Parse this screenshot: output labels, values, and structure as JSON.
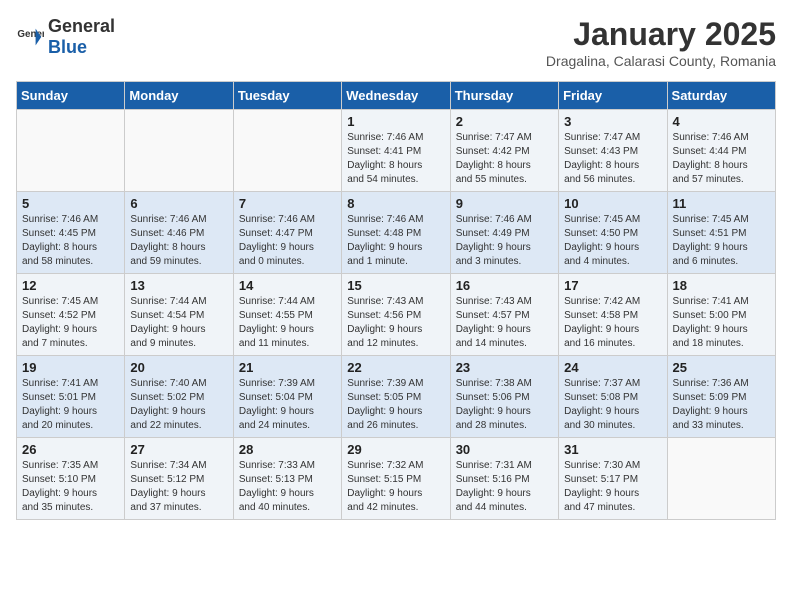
{
  "header": {
    "logo_general": "General",
    "logo_blue": "Blue",
    "title": "January 2025",
    "subtitle": "Dragalina, Calarasi County, Romania"
  },
  "weekdays": [
    "Sunday",
    "Monday",
    "Tuesday",
    "Wednesday",
    "Thursday",
    "Friday",
    "Saturday"
  ],
  "weeks": [
    [
      {
        "day": "",
        "info": ""
      },
      {
        "day": "",
        "info": ""
      },
      {
        "day": "",
        "info": ""
      },
      {
        "day": "1",
        "info": "Sunrise: 7:46 AM\nSunset: 4:41 PM\nDaylight: 8 hours\nand 54 minutes."
      },
      {
        "day": "2",
        "info": "Sunrise: 7:47 AM\nSunset: 4:42 PM\nDaylight: 8 hours\nand 55 minutes."
      },
      {
        "day": "3",
        "info": "Sunrise: 7:47 AM\nSunset: 4:43 PM\nDaylight: 8 hours\nand 56 minutes."
      },
      {
        "day": "4",
        "info": "Sunrise: 7:46 AM\nSunset: 4:44 PM\nDaylight: 8 hours\nand 57 minutes."
      }
    ],
    [
      {
        "day": "5",
        "info": "Sunrise: 7:46 AM\nSunset: 4:45 PM\nDaylight: 8 hours\nand 58 minutes."
      },
      {
        "day": "6",
        "info": "Sunrise: 7:46 AM\nSunset: 4:46 PM\nDaylight: 8 hours\nand 59 minutes."
      },
      {
        "day": "7",
        "info": "Sunrise: 7:46 AM\nSunset: 4:47 PM\nDaylight: 9 hours\nand 0 minutes."
      },
      {
        "day": "8",
        "info": "Sunrise: 7:46 AM\nSunset: 4:48 PM\nDaylight: 9 hours\nand 1 minute."
      },
      {
        "day": "9",
        "info": "Sunrise: 7:46 AM\nSunset: 4:49 PM\nDaylight: 9 hours\nand 3 minutes."
      },
      {
        "day": "10",
        "info": "Sunrise: 7:45 AM\nSunset: 4:50 PM\nDaylight: 9 hours\nand 4 minutes."
      },
      {
        "day": "11",
        "info": "Sunrise: 7:45 AM\nSunset: 4:51 PM\nDaylight: 9 hours\nand 6 minutes."
      }
    ],
    [
      {
        "day": "12",
        "info": "Sunrise: 7:45 AM\nSunset: 4:52 PM\nDaylight: 9 hours\nand 7 minutes."
      },
      {
        "day": "13",
        "info": "Sunrise: 7:44 AM\nSunset: 4:54 PM\nDaylight: 9 hours\nand 9 minutes."
      },
      {
        "day": "14",
        "info": "Sunrise: 7:44 AM\nSunset: 4:55 PM\nDaylight: 9 hours\nand 11 minutes."
      },
      {
        "day": "15",
        "info": "Sunrise: 7:43 AM\nSunset: 4:56 PM\nDaylight: 9 hours\nand 12 minutes."
      },
      {
        "day": "16",
        "info": "Sunrise: 7:43 AM\nSunset: 4:57 PM\nDaylight: 9 hours\nand 14 minutes."
      },
      {
        "day": "17",
        "info": "Sunrise: 7:42 AM\nSunset: 4:58 PM\nDaylight: 9 hours\nand 16 minutes."
      },
      {
        "day": "18",
        "info": "Sunrise: 7:41 AM\nSunset: 5:00 PM\nDaylight: 9 hours\nand 18 minutes."
      }
    ],
    [
      {
        "day": "19",
        "info": "Sunrise: 7:41 AM\nSunset: 5:01 PM\nDaylight: 9 hours\nand 20 minutes."
      },
      {
        "day": "20",
        "info": "Sunrise: 7:40 AM\nSunset: 5:02 PM\nDaylight: 9 hours\nand 22 minutes."
      },
      {
        "day": "21",
        "info": "Sunrise: 7:39 AM\nSunset: 5:04 PM\nDaylight: 9 hours\nand 24 minutes."
      },
      {
        "day": "22",
        "info": "Sunrise: 7:39 AM\nSunset: 5:05 PM\nDaylight: 9 hours\nand 26 minutes."
      },
      {
        "day": "23",
        "info": "Sunrise: 7:38 AM\nSunset: 5:06 PM\nDaylight: 9 hours\nand 28 minutes."
      },
      {
        "day": "24",
        "info": "Sunrise: 7:37 AM\nSunset: 5:08 PM\nDaylight: 9 hours\nand 30 minutes."
      },
      {
        "day": "25",
        "info": "Sunrise: 7:36 AM\nSunset: 5:09 PM\nDaylight: 9 hours\nand 33 minutes."
      }
    ],
    [
      {
        "day": "26",
        "info": "Sunrise: 7:35 AM\nSunset: 5:10 PM\nDaylight: 9 hours\nand 35 minutes."
      },
      {
        "day": "27",
        "info": "Sunrise: 7:34 AM\nSunset: 5:12 PM\nDaylight: 9 hours\nand 37 minutes."
      },
      {
        "day": "28",
        "info": "Sunrise: 7:33 AM\nSunset: 5:13 PM\nDaylight: 9 hours\nand 40 minutes."
      },
      {
        "day": "29",
        "info": "Sunrise: 7:32 AM\nSunset: 5:15 PM\nDaylight: 9 hours\nand 42 minutes."
      },
      {
        "day": "30",
        "info": "Sunrise: 7:31 AM\nSunset: 5:16 PM\nDaylight: 9 hours\nand 44 minutes."
      },
      {
        "day": "31",
        "info": "Sunrise: 7:30 AM\nSunset: 5:17 PM\nDaylight: 9 hours\nand 47 minutes."
      },
      {
        "day": "",
        "info": ""
      }
    ]
  ]
}
